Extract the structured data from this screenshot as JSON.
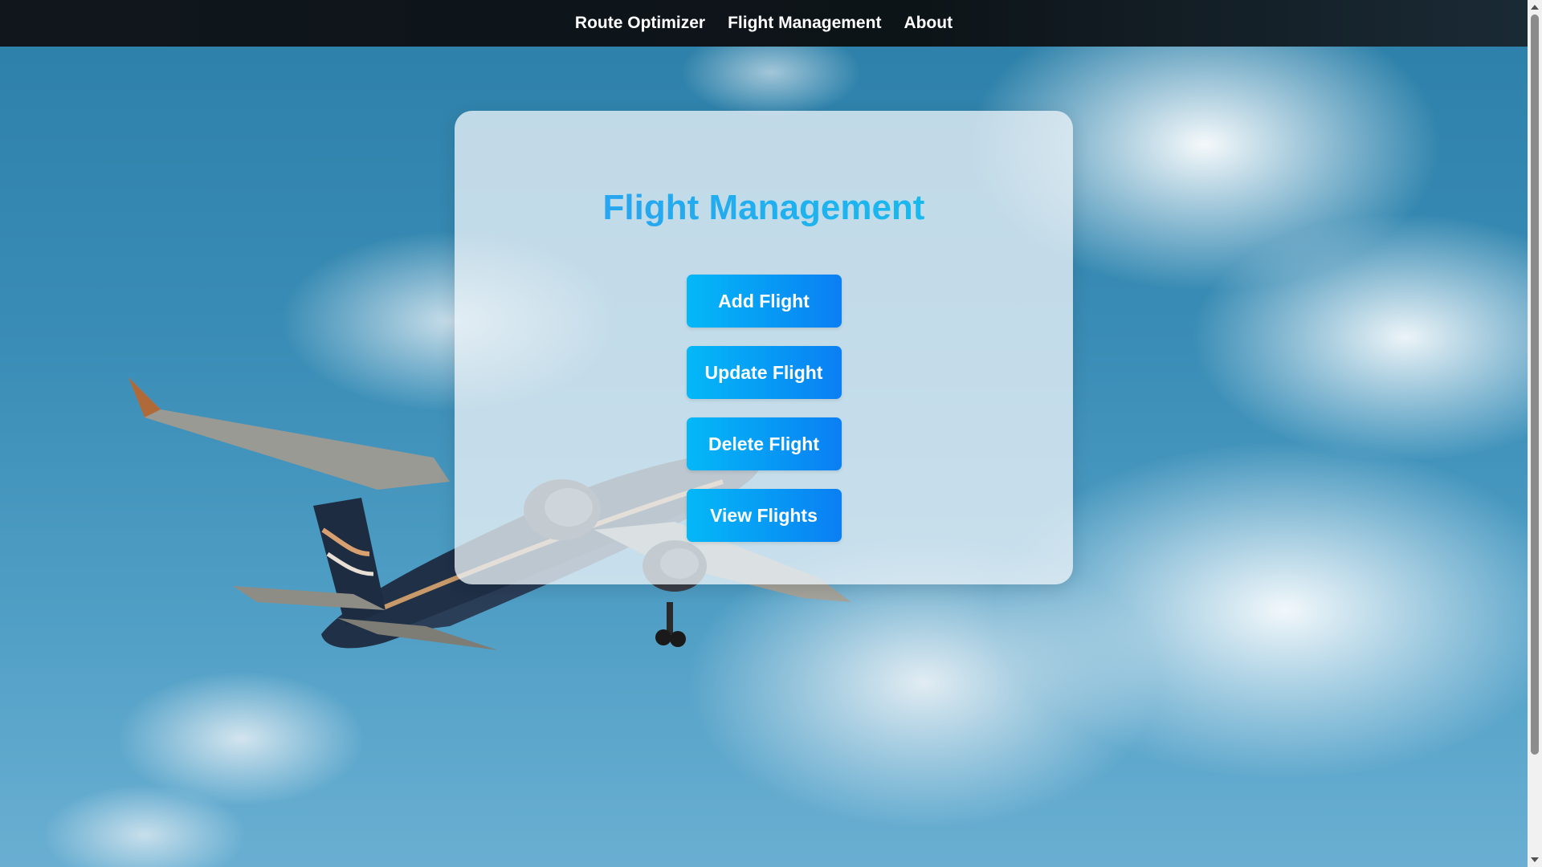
{
  "navbar": {
    "links": [
      {
        "label": "Route Optimizer"
      },
      {
        "label": "Flight Management"
      },
      {
        "label": "About"
      }
    ]
  },
  "card": {
    "title": "Flight Management",
    "buttons": [
      {
        "label": "Add Flight"
      },
      {
        "label": "Update Flight"
      },
      {
        "label": "Delete Flight"
      },
      {
        "label": "View Flights"
      }
    ]
  },
  "colors": {
    "navbar_bg": "#10161c",
    "button_gradient_start": "#04b8f7",
    "button_gradient_end": "#0a7ff3",
    "title_gradient_start": "#2f9cf0",
    "title_gradient_end": "#12c2ee"
  },
  "background": {
    "icon": "airplane-icon"
  }
}
